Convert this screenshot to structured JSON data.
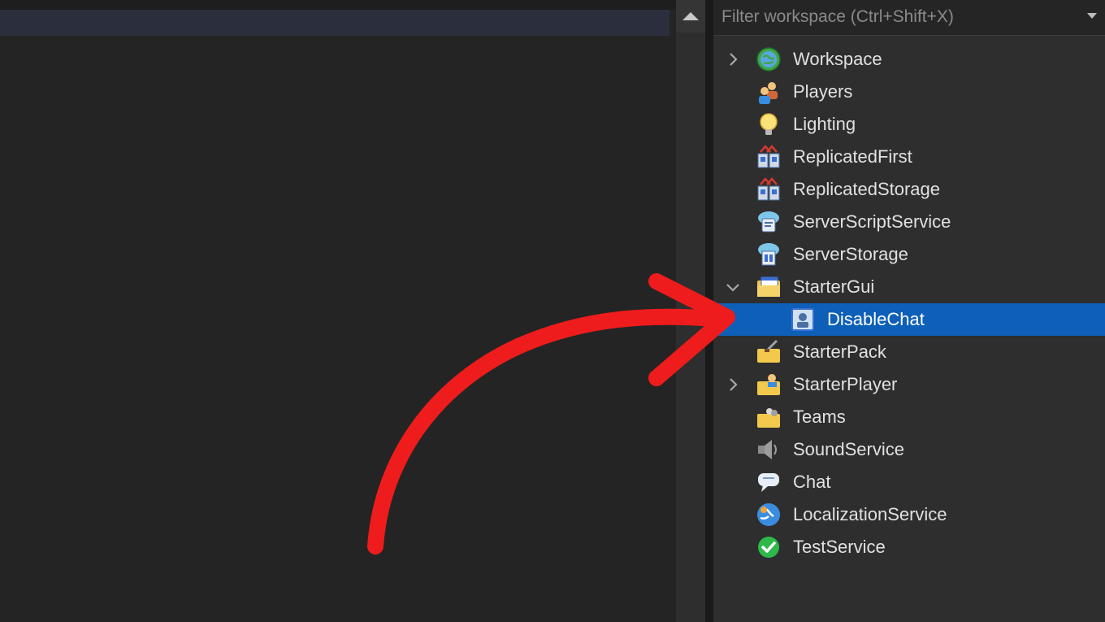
{
  "filter": {
    "placeholder": "Filter workspace (Ctrl+Shift+X)"
  },
  "explorer": {
    "items": [
      {
        "label": "Workspace",
        "icon": "globe-icon",
        "expander": "collapsed"
      },
      {
        "label": "Players",
        "icon": "players-icon",
        "expander": "none"
      },
      {
        "label": "Lighting",
        "icon": "lightbulb-icon",
        "expander": "none"
      },
      {
        "label": "ReplicatedFirst",
        "icon": "replicated-icon",
        "expander": "none"
      },
      {
        "label": "ReplicatedStorage",
        "icon": "replicated-icon",
        "expander": "none"
      },
      {
        "label": "ServerScriptService",
        "icon": "server-script-icon",
        "expander": "none"
      },
      {
        "label": "ServerStorage",
        "icon": "server-storage-icon",
        "expander": "none"
      },
      {
        "label": "StarterGui",
        "icon": "folder-gui-icon",
        "expander": "expanded"
      },
      {
        "label": "DisableChat",
        "icon": "screen-gui-icon",
        "expander": "none",
        "selected": true,
        "indent": 1
      },
      {
        "label": "StarterPack",
        "icon": "folder-pack-icon",
        "expander": "none"
      },
      {
        "label": "StarterPlayer",
        "icon": "folder-player-icon",
        "expander": "collapsed"
      },
      {
        "label": "Teams",
        "icon": "folder-teams-icon",
        "expander": "none"
      },
      {
        "label": "SoundService",
        "icon": "speaker-icon",
        "expander": "none"
      },
      {
        "label": "Chat",
        "icon": "chat-bubble-icon",
        "expander": "none"
      },
      {
        "label": "LocalizationService",
        "icon": "localization-icon",
        "expander": "none"
      },
      {
        "label": "TestService",
        "icon": "checkmark-icon",
        "expander": "none"
      }
    ]
  },
  "colors": {
    "selection": "#0d5fb8",
    "arrow": "#ee1c1c",
    "panel": "#2e2e2e",
    "editor": "#242424"
  }
}
